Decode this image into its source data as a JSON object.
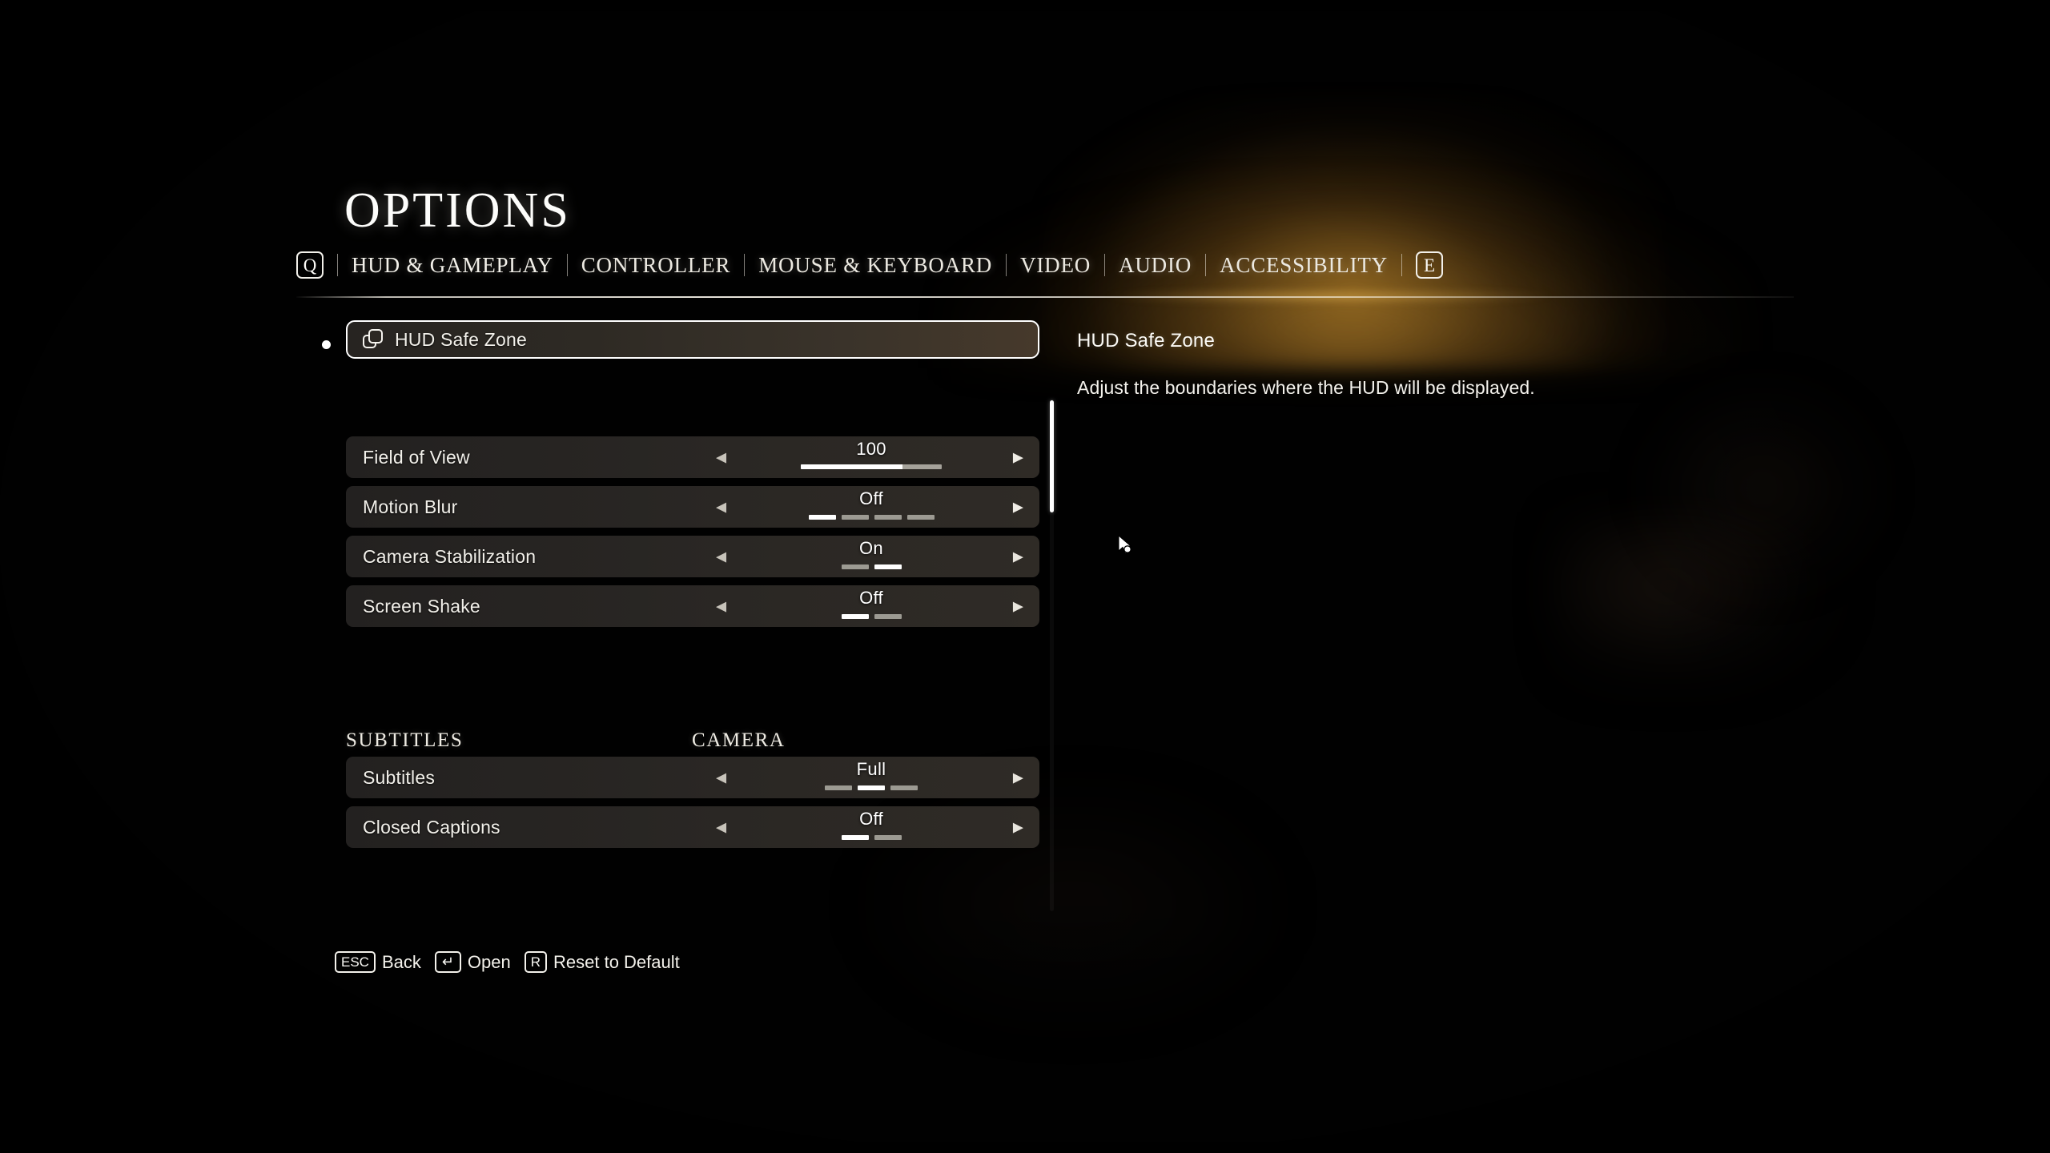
{
  "header": {
    "title": "OPTIONS",
    "prev_key": "Q",
    "next_key": "E",
    "tabs": [
      {
        "label": "HUD & GAMEPLAY",
        "active": true
      },
      {
        "label": "CONTROLLER",
        "active": false
      },
      {
        "label": "MOUSE & KEYBOARD",
        "active": false
      },
      {
        "label": "VIDEO",
        "active": false
      },
      {
        "label": "AUDIO",
        "active": false
      },
      {
        "label": "ACCESSIBILITY",
        "active": false
      }
    ]
  },
  "selected_row": {
    "label": "HUD Safe Zone",
    "icon": "layers-icon"
  },
  "sections": [
    {
      "heading": "CAMERA",
      "rows": [
        {
          "label": "Field of View",
          "value": "100",
          "control": "slider",
          "fill_percent": 72
        },
        {
          "label": "Motion Blur",
          "value": "Off",
          "control": "segmented",
          "segments": 4,
          "selected_index": 0
        },
        {
          "label": "Camera Stabilization",
          "value": "On",
          "control": "segmented",
          "segments": 2,
          "selected_index": 1
        },
        {
          "label": "Screen Shake",
          "value": "Off",
          "control": "segmented",
          "segments": 2,
          "selected_index": 0
        }
      ]
    },
    {
      "heading": "SUBTITLES",
      "rows": [
        {
          "label": "Subtitles",
          "value": "Full",
          "control": "segmented",
          "segments": 3,
          "selected_index": 1
        },
        {
          "label": "Closed Captions",
          "value": "Off",
          "control": "segmented",
          "segments": 2,
          "selected_index": 0
        }
      ]
    }
  ],
  "description": {
    "title": "HUD Safe Zone",
    "body": "Adjust the boundaries where the HUD will be displayed."
  },
  "footer_hints": [
    {
      "key": "ESC",
      "glyph": "ESC",
      "label": "Back"
    },
    {
      "key": "ENTER",
      "glyph": "↵",
      "label": "Open"
    },
    {
      "key": "R",
      "glyph": "R",
      "label": "Reset to Default"
    }
  ],
  "arrows": {
    "left": "◀",
    "right": "▶"
  },
  "colors": {
    "accent_glow": "#e0a034",
    "row_background": "#2a2724",
    "selected_border": "#ffffff",
    "segment_on": "#ffffff",
    "segment_off": "#9c9a92",
    "text_primary": "#f4f2ec"
  }
}
